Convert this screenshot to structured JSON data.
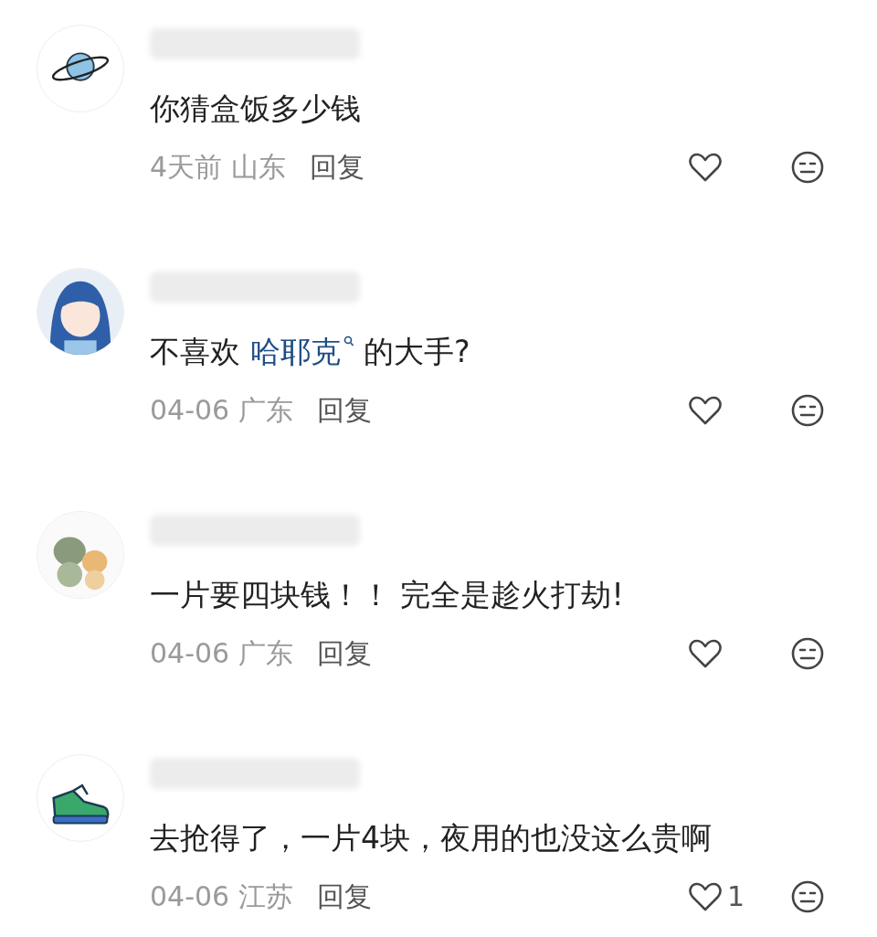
{
  "comments": [
    {
      "avatar": {
        "kind": "planet"
      },
      "segments": [
        {
          "kind": "text",
          "text": "你猜盒饭多少钱"
        }
      ],
      "time": "4天前",
      "location": "山东",
      "reply": "回复"
    },
    {
      "avatar": {
        "kind": "figure"
      },
      "segments": [
        {
          "kind": "text",
          "text": "不喜欢 "
        },
        {
          "kind": "link",
          "text": "哈耶克"
        },
        {
          "kind": "text",
          "text": " 的大手?"
        }
      ],
      "time": "04-06",
      "location": "广东",
      "reply": "回复"
    },
    {
      "avatar": {
        "kind": "pets"
      },
      "segments": [
        {
          "kind": "text",
          "text": "一片要四块钱！！ 完全是趁火打劫!"
        }
      ],
      "time": "04-06",
      "location": "广东",
      "reply": "回复"
    },
    {
      "avatar": {
        "kind": "shoe"
      },
      "segments": [
        {
          "kind": "text",
          "text": "去抢得了，一片4块，夜用的也没这么贵啊"
        }
      ],
      "time": "04-06",
      "location": "江苏",
      "reply": "回复",
      "likes": "1"
    }
  ]
}
